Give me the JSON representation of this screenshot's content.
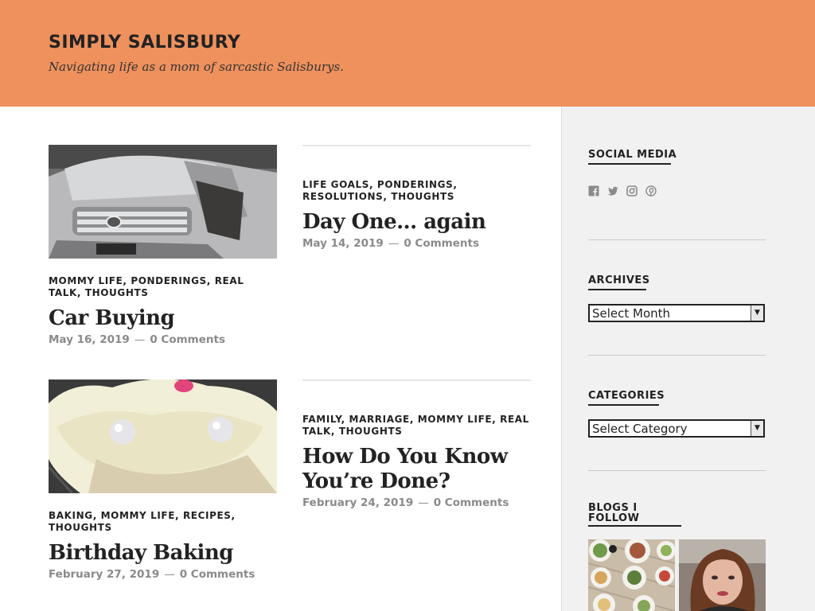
{
  "site": {
    "title": "SIMPLY SALISBURY",
    "description": "Navigating life as a mom of sarcastic Salisburys."
  },
  "posts": [
    {
      "categories": "MOMMY LIFE, PONDERINGS, REAL TALK, THOUGHTS",
      "title": "Car Buying",
      "date": "May 16, 2019",
      "comments": "0 Comments",
      "has_image": true
    },
    {
      "categories": "LIFE GOALS, PONDERINGS, RESOLUTIONS, THOUGHTS",
      "title": "Day One… again",
      "date": "May 14, 2019",
      "comments": "0 Comments",
      "has_image": false
    },
    {
      "categories": "BAKING, MOMMY LIFE, RECIPES, THOUGHTS",
      "title": "Birthday Baking",
      "date": "February 27, 2019",
      "comments": "0 Comments",
      "has_image": true
    },
    {
      "categories": "FAMILY, MARRIAGE, MOMMY LIFE, REAL TALK, THOUGHTS",
      "title": "How Do You Know You’re Done?",
      "date": "February 24, 2019",
      "comments": "0 Comments",
      "has_image": false
    }
  ],
  "meta_separator": "—",
  "sidebar": {
    "social": {
      "title": "SOCIAL MEDIA",
      "icons": [
        "facebook-icon",
        "twitter-icon",
        "instagram-icon",
        "pinterest-icon"
      ]
    },
    "archives": {
      "title": "ARCHIVES",
      "selected": "Select Month"
    },
    "categories": {
      "title": "CATEGORIES",
      "selected": "Select Category"
    },
    "blogs": {
      "title_line1": "BLOGS I",
      "title_line2": "FOLLOW"
    }
  },
  "colors": {
    "header_bg": "#ee915d",
    "content_bg": "#ffffff",
    "sidebar_bg": "#f1f1f1",
    "meta_text": "#8a8a8a"
  }
}
